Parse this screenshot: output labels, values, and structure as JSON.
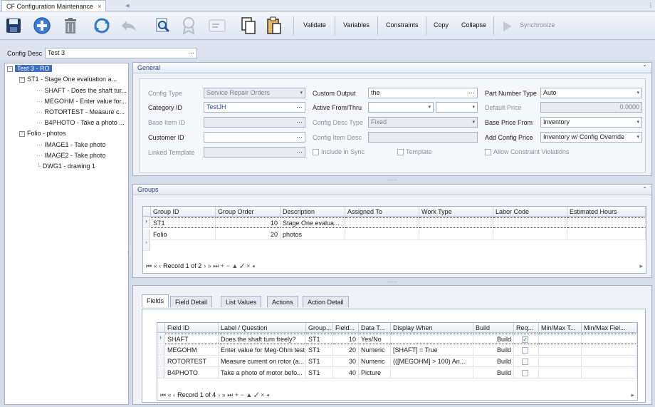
{
  "window": {
    "tab_title": "CF Configuration Maintenance",
    "tab_close": "×"
  },
  "toolbar": {
    "validate": "Validate",
    "variables": "Variables",
    "constraints": "Constraints",
    "copy": "Copy",
    "collapse": "Collapse",
    "synchronize": "Synchronize"
  },
  "config_desc": {
    "label": "Config Desc",
    "value": "Test 3"
  },
  "tree": {
    "root": "Test 3 - RO",
    "groups": [
      {
        "label": "ST1 - Stage One evaluation a...",
        "items": [
          "SHAFT - Does the shaft tur...",
          "MEGOHM - Enter value for...",
          "ROTORTEST - Measure c...",
          "B4PHOTO - Take a photo ..."
        ]
      },
      {
        "label": "Folio - photos",
        "items": [
          "IMAGE1 - Take photo",
          "IMAGE2 - Take photo",
          "DWG1 - drawing 1"
        ]
      }
    ]
  },
  "general": {
    "title": "General",
    "config_type_label": "Config Type",
    "config_type": "Service Repair Orders",
    "category_id_label": "Category ID",
    "category_id": "TestJH",
    "base_item_id_label": "Base Item ID",
    "base_item_id": "",
    "customer_id_label": "Customer ID",
    "customer_id": "",
    "linked_template_label": "Linked Template",
    "linked_template": "",
    "custom_output_label": "Custom Output",
    "custom_output": "the",
    "active_from_label": "Active From/Thru",
    "active_from": "",
    "active_thru": "",
    "config_desc_type_label": "Config Desc Type",
    "config_desc_type": "Fixed",
    "config_item_desc_label": "Config Item Desc",
    "config_item_desc": "",
    "include_in_sync": "Include in Sync",
    "template": "Template",
    "part_number_type_label": "Part Number Type",
    "part_number_type": "Auto",
    "default_price_label": "Default Price",
    "default_price": "0.0000",
    "base_price_from_label": "Base Price From",
    "base_price_from": "Inventory",
    "add_config_price_label": "Add Config Price",
    "add_config_price": "Inventory w/ Config Override",
    "allow_constraint_violations": "Allow Constraint Violations"
  },
  "groups": {
    "title": "Groups",
    "columns": [
      "Group ID",
      "Group Order",
      "Description",
      "Assigned To",
      "Work Type",
      "Labor Code",
      "Estimated Hours"
    ],
    "rows": [
      {
        "group_id": "ST1",
        "order": "10",
        "description": "Stage One evalua..."
      },
      {
        "group_id": "Folio",
        "order": "20",
        "description": "photos"
      }
    ],
    "record": "Record 1 of 2"
  },
  "fields": {
    "tabs": [
      "Fields",
      "Field Detail",
      "List Values",
      "Actions",
      "Action Detail"
    ],
    "columns": [
      "Field ID",
      "Label / Question",
      "Group...",
      "Field...",
      "Data T...",
      "Display When",
      "Build",
      "Req...",
      "Min/Max T...",
      "Min/Max Fiel..."
    ],
    "rows": [
      {
        "id": "SHAFT",
        "label": "Does the shaft turn freely?",
        "group": "ST1",
        "order": "10",
        "type": "Yes/No",
        "display": "",
        "build": "Build",
        "req": true
      },
      {
        "id": "MEGOHM",
        "label": "Enter value for Meg-Ohm test",
        "group": "ST1",
        "order": "20",
        "type": "Numeric",
        "display": "[SHAFT] = True",
        "build": "Build",
        "req": false
      },
      {
        "id": "ROTORTEST",
        "label": "Measure current on rotor (a...",
        "group": "ST1",
        "order": "30",
        "type": "Numeric",
        "display": "(([MEGOHM] > 100) An...",
        "build": "Build",
        "req": false
      },
      {
        "id": "B4PHOTO",
        "label": "Take a photo of motor befo...",
        "group": "ST1",
        "order": "40",
        "type": "Picture",
        "display": "",
        "build": "Build",
        "req": false
      }
    ],
    "record": "Record 1 of 4"
  },
  "colors": {
    "accent": "#3d6fc4",
    "panel_header": "#1e3f7a"
  }
}
